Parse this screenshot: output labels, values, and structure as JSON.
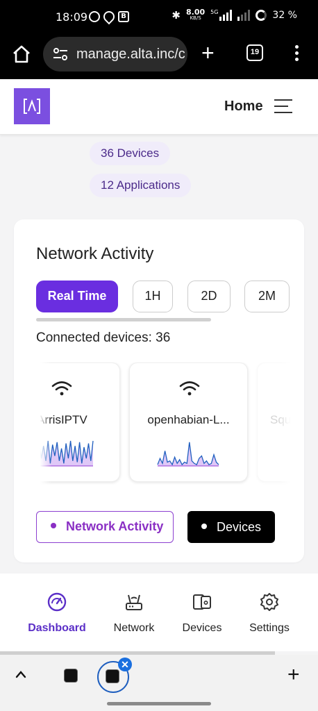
{
  "status_bar": {
    "time": "18:09",
    "net_speed_value": "8.00",
    "net_speed_unit": "KB/S",
    "network_type": "5G",
    "battery": "32 %"
  },
  "browser": {
    "url": "manage.alta.inc/c",
    "tab_count": "19"
  },
  "site_header": {
    "nav_label": "Home"
  },
  "summary_pills": [
    {
      "label": "36 Devices"
    },
    {
      "label": "12 Applications"
    }
  ],
  "network_card": {
    "title": "Network Activity",
    "timeframes": [
      "Real Time",
      "1H",
      "2D",
      "2M"
    ],
    "active_timeframe": "Real Time",
    "connected_label": "Connected devices: 36",
    "devices": [
      {
        "name": "ArrisIPTV",
        "icon": "wifi-icon",
        "chart_color": "#1f5fbf",
        "activity": [
          0.1,
          0.9,
          0.3,
          0.8,
          0.2,
          1.0,
          0.1,
          0.85,
          0.4,
          0.95,
          0.2,
          0.7,
          0.1,
          0.9,
          0.3,
          1.0,
          0.2,
          0.8,
          0.15,
          0.95,
          0.1,
          0.75,
          0.3,
          0.9,
          0.2,
          1.0
        ]
      },
      {
        "name": "openhabian-L...",
        "icon": "wifi-icon",
        "chart_color": "#1f5fbf",
        "activity": [
          0.05,
          0.3,
          0.1,
          0.6,
          0.15,
          0.2,
          0.05,
          0.35,
          0.1,
          0.25,
          0.05,
          0.15,
          0.1,
          0.95,
          0.2,
          0.1,
          0.05,
          0.3,
          0.4,
          0.1,
          0.2,
          0.05,
          0.1,
          0.45,
          0.15,
          0.05
        ]
      },
      {
        "name": "Squ",
        "icon": "wifi-icon",
        "chart_color": "#999999",
        "activity": []
      }
    ],
    "buttons": {
      "network_activity": "Network Activity",
      "devices": "Devices"
    }
  },
  "bottom_nav": {
    "items": [
      {
        "label": "Dashboard",
        "icon": "gauge-icon",
        "active": true
      },
      {
        "label": "Network",
        "icon": "router-icon",
        "active": false
      },
      {
        "label": "Devices",
        "icon": "devices-icon",
        "active": false
      },
      {
        "label": "Settings",
        "icon": "gear-icon",
        "active": false
      }
    ]
  },
  "colors": {
    "brand_purple": "#6a2ee0",
    "accent_purple": "#8a2fc4",
    "pill_bg": "#f0ecfa"
  }
}
